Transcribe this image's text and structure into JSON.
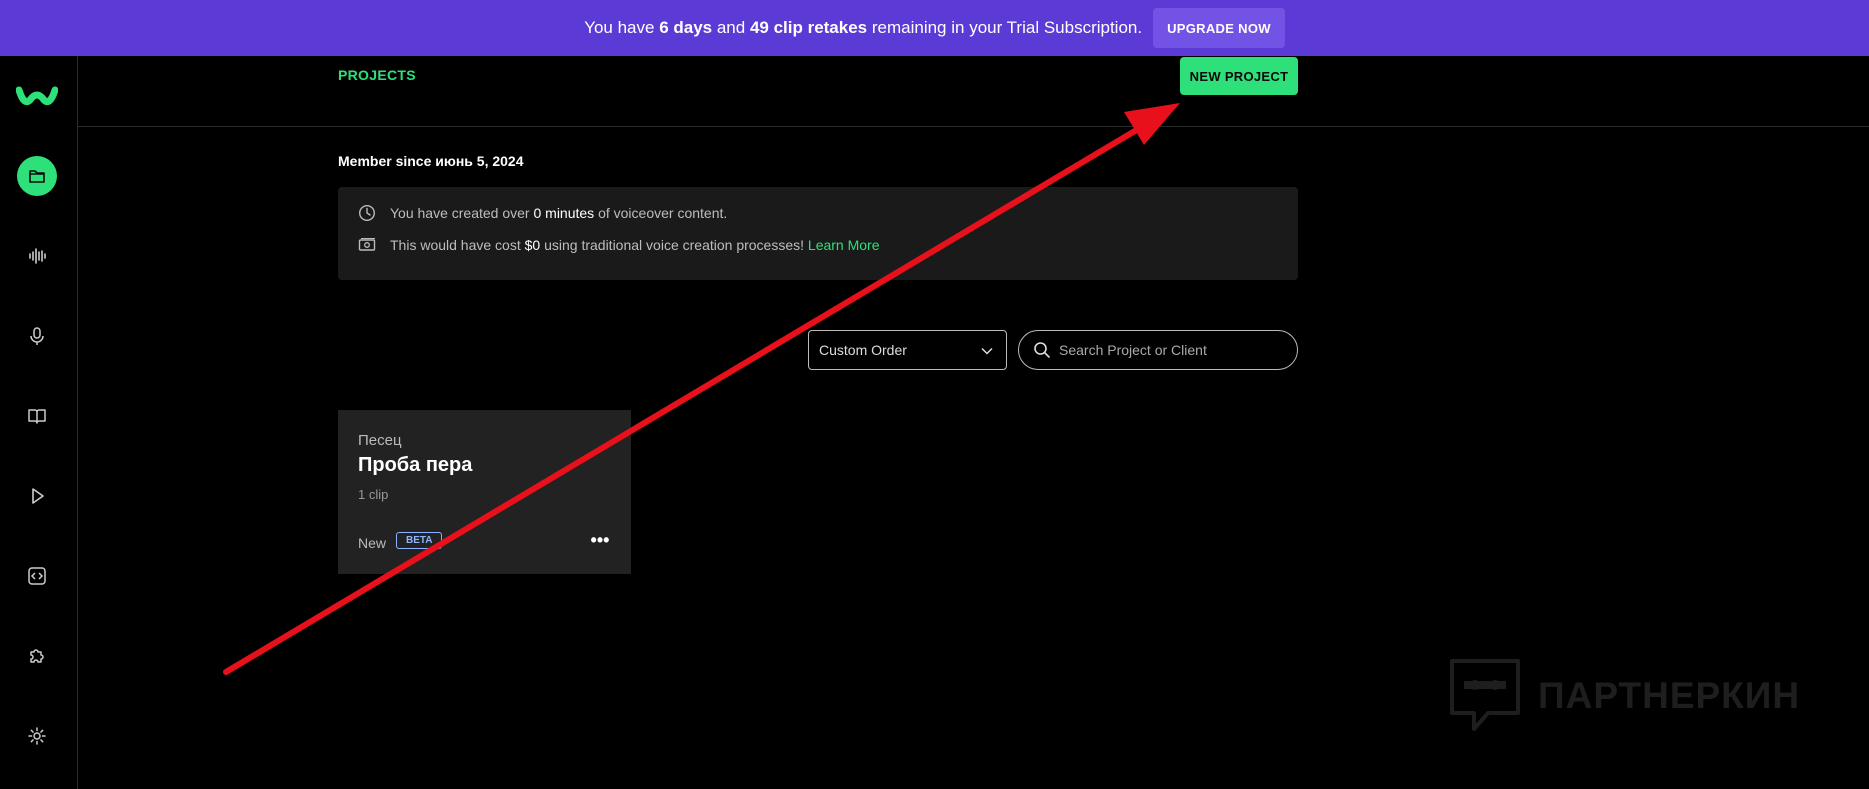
{
  "banner": {
    "prefix": "You have ",
    "days": "6 days",
    "mid": " and ",
    "retakes": "49 clip retakes",
    "suffix": " remaining in your Trial Subscription.",
    "upgrade_label": "UPGRADE NOW"
  },
  "sidebar": {
    "items": [
      {
        "icon": "folder-icon",
        "active": true
      },
      {
        "icon": "waveform-icon",
        "active": false
      },
      {
        "icon": "microphone-icon",
        "active": false
      },
      {
        "icon": "book-icon",
        "active": false
      },
      {
        "icon": "play-icon",
        "active": false
      },
      {
        "icon": "code-icon",
        "active": false
      },
      {
        "icon": "puzzle-icon",
        "active": false
      },
      {
        "icon": "gear-icon",
        "active": false
      }
    ]
  },
  "header": {
    "tab_label": "PROJECTS",
    "new_project_label": "NEW PROJECT"
  },
  "member": {
    "label": "Member since июнь 5, 2024"
  },
  "stats": {
    "row1_prefix": "You have created over ",
    "row1_value": "0 minutes",
    "row1_suffix": " of voiceover content.",
    "row2_prefix": "This would have cost ",
    "row2_value": "$0",
    "row2_suffix": " using traditional voice creation processes! ",
    "learn_more": "Learn More"
  },
  "filters": {
    "order_value": "Custom Order",
    "search_placeholder": "Search Project or Client"
  },
  "projects": [
    {
      "client": "Песец",
      "title": "Проба пера",
      "clips": "1 clip",
      "status": "New",
      "badge": "BETA"
    }
  ],
  "watermark": {
    "text": "ПАРТНЕРКИН"
  },
  "colors": {
    "accent": "#2ee07a",
    "banner": "#5c3ad6",
    "annotation_arrow": "#e8101a"
  }
}
